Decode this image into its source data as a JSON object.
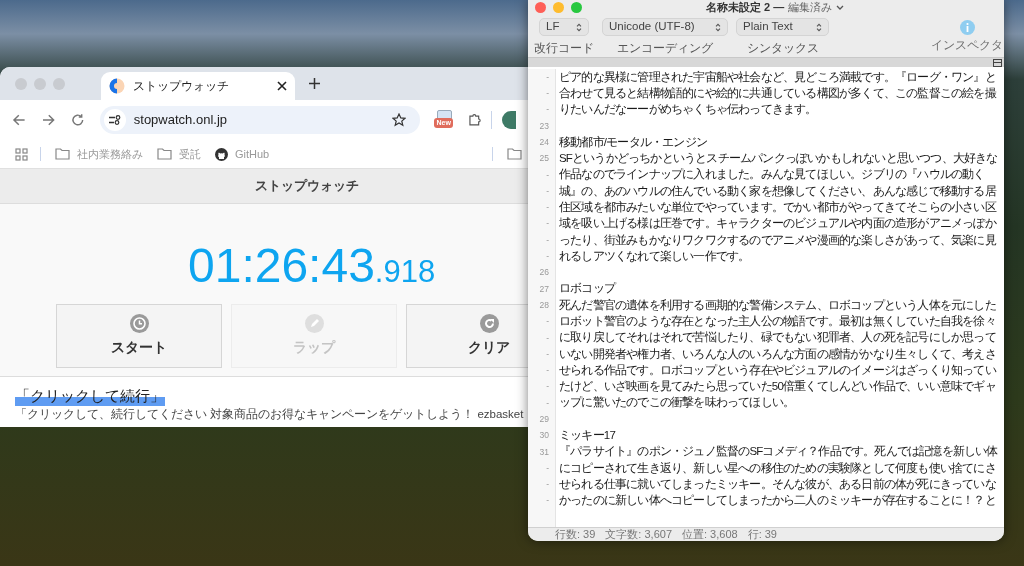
{
  "browser": {
    "tab": {
      "title": "ストップウォッチ",
      "selected": true
    },
    "address": "stopwatch.onl.jp",
    "extension_badge": "New",
    "bookmarks": [
      {
        "label": "社内業務絡み",
        "kind": "folder"
      },
      {
        "label": "受託",
        "kind": "folder"
      },
      {
        "label": "GitHub",
        "kind": "github"
      }
    ],
    "page": {
      "header": "ストップウォッチ",
      "time": "01:26:43",
      "milliseconds": ".918",
      "buttons": [
        {
          "label": "スタート",
          "kind": "start",
          "disabled": false
        },
        {
          "label": "ラップ",
          "kind": "lap",
          "disabled": true
        },
        {
          "label": "クリア",
          "kind": "clear",
          "disabled": false
        }
      ],
      "ad": {
        "title": "「クリックして続行」",
        "text": "「クリックして、続行してください 対象商品のお得なキャンペーンをゲットしよう！ ezbasket"
      }
    }
  },
  "editor": {
    "title": "名称未設定 2 —",
    "document_status": "編集済み",
    "popups": [
      {
        "value": "LF",
        "label": "改行コード"
      },
      {
        "value": "Unicode (UTF-8)",
        "label": "エンコーディング"
      },
      {
        "value": "Plain Text",
        "label": "シンタックス"
      }
    ],
    "inspector": "インスペクタ",
    "lines": [
      {
        "number": "-",
        "text": "ピア的な異様に管理された宇宙船や社会など、見どころ満載です。『ローグ・ワン』と"
      },
      {
        "number": "-",
        "text": "合わせて見ると結構物語的にや絵的に共通している構図が多くて、この監督この絵を撮"
      },
      {
        "number": "-",
        "text": "りたいんだなーーがめちゃくちゃ伝わってきます。"
      },
      {
        "number": "23"
      },
      {
        "number": "24",
        "text": "移動都市/モータル・エンジン"
      },
      {
        "number": "25",
        "text": "SFというかどっちかというとスチームパンクっぽいかもしれないと思いつつ、大好きな"
      },
      {
        "number": "-",
        "text": "作品なのでラインナップに入れました。みんな見てほしい。ジブリの『ハウルの動く"
      },
      {
        "number": "-",
        "text": "城』の、あのハウルの住んでいる動く家を想像してください、あんな感じで移動する居"
      },
      {
        "number": "-",
        "text": "住区域を都市みたいな単位でやっています。でかい都市がやってきてそこらの小さい区"
      },
      {
        "number": "-",
        "text": "域を吸い上げる様は圧巻です。キャラクターのビジュアルや内面の造形がアニメっぽか"
      },
      {
        "number": "-",
        "text": "ったり、街並みもかなりワクワクするのでアニメや漫画的な楽しさがあって、気楽に見"
      },
      {
        "number": "-",
        "text": "れるしアツくなれて楽しい一作です。"
      },
      {
        "number": "26"
      },
      {
        "number": "27",
        "text": "ロボコップ"
      },
      {
        "number": "28",
        "text": "死んだ警官の遺体を利用する画期的な警備システム、ロボコップという人体を元にした"
      },
      {
        "number": "-",
        "text": "ロボット警官のような存在となった主人公の物語です。最初は無くしていた自我を徐々"
      },
      {
        "number": "-",
        "text": "に取り戻してそれはそれで苦悩したり、碌でもない犯罪者、人の死を記号にしか思って"
      },
      {
        "number": "-",
        "text": "いない開発者や権力者、いろんな人のいろんな方面の感情がかなり生々しくて、考えさ"
      },
      {
        "number": "-",
        "text": "せられる作品です。ロボコップという存在やビジュアルのイメージはざっくり知ってい"
      },
      {
        "number": "-",
        "text": "たけど、いざ映画を見てみたら思っていた50倍重くてしんどい作品で、いい意味でギャ"
      },
      {
        "number": "-",
        "text": "ップに驚いたのでこの衝撃を味わってほしい。"
      },
      {
        "number": "29"
      },
      {
        "number": "30",
        "text": "ミッキー17"
      },
      {
        "number": "31",
        "text": "『パラサイト』のポン・ジュノ監督のSFコメディ？作品です。死んでは記憶を新しい体"
      },
      {
        "number": "-",
        "text": "にコピーされて生き返り、新しい星への移住のための実験隊として何度も使い捨てにさ"
      },
      {
        "number": "-",
        "text": "せられる仕事に就いてしまったミッキー。そんな彼が、ある日前の体が死にきっていな"
      },
      {
        "number": "-",
        "text": "かったのに新しい体へコピーしてしまったから二人のミッキーが存在することに！？と"
      }
    ],
    "status_bar": [
      "行数: 39",
      "文字数: 3,607",
      "位置: 3,608",
      "行: 39"
    ]
  }
}
